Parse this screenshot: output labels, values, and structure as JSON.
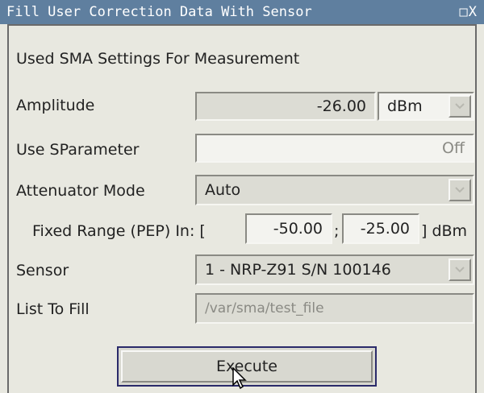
{
  "window": {
    "title": "Fill User Correction Data With Sensor",
    "controls": "□X"
  },
  "section_heading": "Used SMA Settings For Measurement",
  "fields": {
    "amplitude": {
      "label": "Amplitude",
      "value": "-26.00",
      "unit": "dBm"
    },
    "use_sparameter": {
      "label": "Use SParameter",
      "value": "Off"
    },
    "attenuator_mode": {
      "label": "Attenuator Mode",
      "value": "Auto"
    },
    "fixed_range": {
      "label": "Fixed Range (PEP) In: [",
      "min": "-50.00",
      "separator": ";",
      "max": "-25.00",
      "unit_suffix": "] dBm"
    },
    "sensor": {
      "label": "Sensor",
      "value": "1 - NRP-Z91 S/N 100146"
    },
    "list_to_fill": {
      "label": "List To Fill",
      "value": "/var/sma/test_file"
    }
  },
  "execute_label": "Execute",
  "icons": {
    "dropdown": "chevron-down-icon",
    "cursor": "mouse-pointer-icon"
  }
}
